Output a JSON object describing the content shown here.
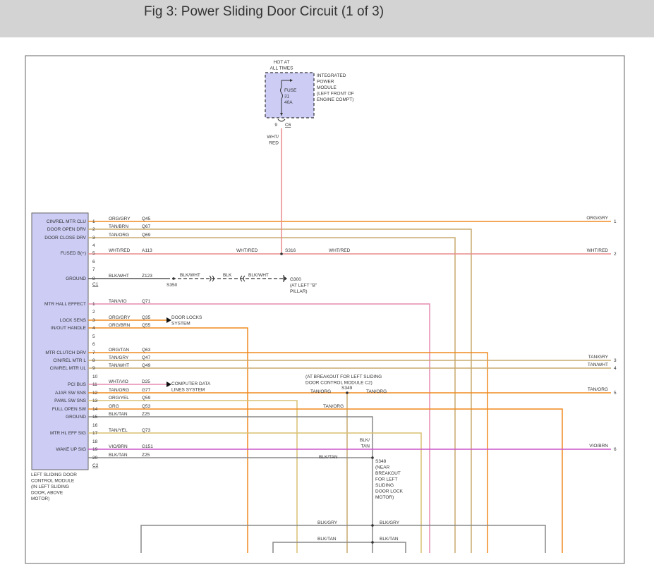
{
  "header": {
    "title": "Fig 3: Power Sliding Door Circuit (1 of 3)"
  },
  "ipm": {
    "hot": [
      "HOT AT",
      "ALL TIMES"
    ],
    "label": [
      "INTEGRATED",
      "POWER",
      "MODULE",
      "(LEFT FRONT OF",
      "ENGINE COMPT)"
    ],
    "fuse": [
      "FUSE",
      "31",
      "40A"
    ],
    "pin": "9",
    "connector": "C6",
    "wire": [
      "WHT/",
      "RED"
    ]
  },
  "module": {
    "label": [
      "LEFT SLIDING DOOR",
      "CONTROL MODULE",
      "(IN LEFT SLIDING",
      "DOOR, ABOVE",
      "MOTOR)"
    ],
    "c1": "C1",
    "c2": "C2",
    "pins": [
      {
        "name": "CIN/REL MTR CLU",
        "pin": "1",
        "color": "ORG/GRY",
        "circuit": "Q45"
      },
      {
        "name": "DOOR OPEN DRV",
        "pin": "2",
        "color": "TAN/BRN",
        "circuit": "Q67"
      },
      {
        "name": "DOOR CLOSE DRV",
        "pin": "3",
        "color": "TAN/ORG",
        "circuit": "Q69"
      },
      {
        "name": "",
        "pin": "4",
        "color": "",
        "circuit": ""
      },
      {
        "name": "FUSED B(+)",
        "pin": "5",
        "color": "WHT/RED",
        "circuit": "A113"
      },
      {
        "name": "",
        "pin": "6",
        "color": "",
        "circuit": ""
      },
      {
        "name": "",
        "pin": "7",
        "color": "",
        "circuit": ""
      },
      {
        "name": "GROUND",
        "pin": "8",
        "color": "BLK/WHT",
        "circuit": "Z123"
      },
      {
        "name": "MTR HALL EFFECT",
        "pin": "1",
        "color": "TAN/VIO",
        "circuit": "Q71"
      },
      {
        "name": "",
        "pin": "2",
        "color": "",
        "circuit": ""
      },
      {
        "name": "LOCK SENS",
        "pin": "3",
        "color": "ORG/GRY",
        "circuit": "Q35"
      },
      {
        "name": "IN/OUT HANDLE",
        "pin": "4",
        "color": "ORG/BRN",
        "circuit": "Q55"
      },
      {
        "name": "",
        "pin": "5",
        "color": "",
        "circuit": ""
      },
      {
        "name": "",
        "pin": "6",
        "color": "",
        "circuit": ""
      },
      {
        "name": "MTR CLUTCH DRV",
        "pin": "7",
        "color": "ORG/TAN",
        "circuit": "Q63"
      },
      {
        "name": "CIN/REL MTR L",
        "pin": "8",
        "color": "TAN/GRY",
        "circuit": "Q47"
      },
      {
        "name": "CIN/REL MTR UL",
        "pin": "9",
        "color": "TAN/WHT",
        "circuit": "Q49"
      },
      {
        "name": "",
        "pin": "10",
        "color": "",
        "circuit": ""
      },
      {
        "name": "PCI BUS",
        "pin": "11",
        "color": "WHT/VIO",
        "circuit": "D25"
      },
      {
        "name": "AJAR SW SNS",
        "pin": "12",
        "color": "TAN/ORG",
        "circuit": "G77"
      },
      {
        "name": "PAWL SW SNS",
        "pin": "13",
        "color": "ORG/YEL",
        "circuit": "Q59"
      },
      {
        "name": "FULL OPEN SW",
        "pin": "14",
        "color": "ORG",
        "circuit": "Q53"
      },
      {
        "name": "GROUND",
        "pin": "15",
        "color": "BLK/TAN",
        "circuit": "Z25"
      },
      {
        "name": "",
        "pin": "16",
        "color": "",
        "circuit": ""
      },
      {
        "name": "MTR HL EFF SIG",
        "pin": "17",
        "color": "TAN/YEL",
        "circuit": "Q73"
      },
      {
        "name": "",
        "pin": "18",
        "color": "",
        "circuit": ""
      },
      {
        "name": "WAKE UP SIG",
        "pin": "19",
        "color": "VIO/BRN",
        "circuit": "G151"
      },
      {
        "name": "",
        "pin": "20",
        "color": "BLK/TAN",
        "circuit": "Z25"
      }
    ]
  },
  "right_edge": [
    {
      "color": "ORG/GRY",
      "num": "1"
    },
    {
      "color": "WHT/RED",
      "num": "2"
    },
    {
      "color": "TAN/GRY",
      "num": "3"
    },
    {
      "color": "TAN/WHT",
      "num": "4"
    },
    {
      "color": "TAN/ORG",
      "num": "5"
    },
    {
      "color": "VIO/BRN",
      "num": "6"
    }
  ],
  "wire_labels": {
    "whtred_mid": "WHT/RED",
    "whtred_after": "WHT/RED",
    "blkwht_a": "BLK/WHT",
    "blk": "BLK",
    "blkwht_b": "BLK/WHT",
    "tanorg_left": "TAN/ORG",
    "tanorg_right": "TAN/ORG",
    "tanorg_down": "TAN/ORG",
    "blktan_mid": "BLK/TAN",
    "blktan_vert": [
      "BLK/",
      "TAN"
    ],
    "blkgry_left": "BLK/GRY",
    "blkgry_right": "BLK/GRY",
    "blktan_low_left": "BLK/TAN",
    "blktan_low_right": "BLK/TAN"
  },
  "splices": {
    "s316": "S316",
    "s350": "S350",
    "s349": "S349",
    "s348": [
      "S348",
      "(NEAR",
      "BREAKOUT",
      "FOR LEFT",
      "SLIDING",
      "DOOR LOCK",
      "MOTOR)"
    ]
  },
  "ground_g300": [
    "G300",
    "(AT LEFT \"B\"",
    "PILLAR)"
  ],
  "breakout_note": [
    "(AT BREAKOUT FOR LEFT SLIDING",
    "DOOR CONTROL MODULE C2)"
  ],
  "door_locks": [
    "DOOR LOCKS",
    "SYSTEM"
  ],
  "computer_data": [
    "COMPUTER DATA",
    "LINES SYSTEM"
  ],
  "colors": {
    "orange": "#f08a1e",
    "tan": "#c8aa6e",
    "red": "#e88c8c",
    "pink": "#e58bb0",
    "violet": "#cc55cc",
    "yellow": "#d8c070",
    "gray": "#888888",
    "module_fill": "#ccccf5"
  }
}
